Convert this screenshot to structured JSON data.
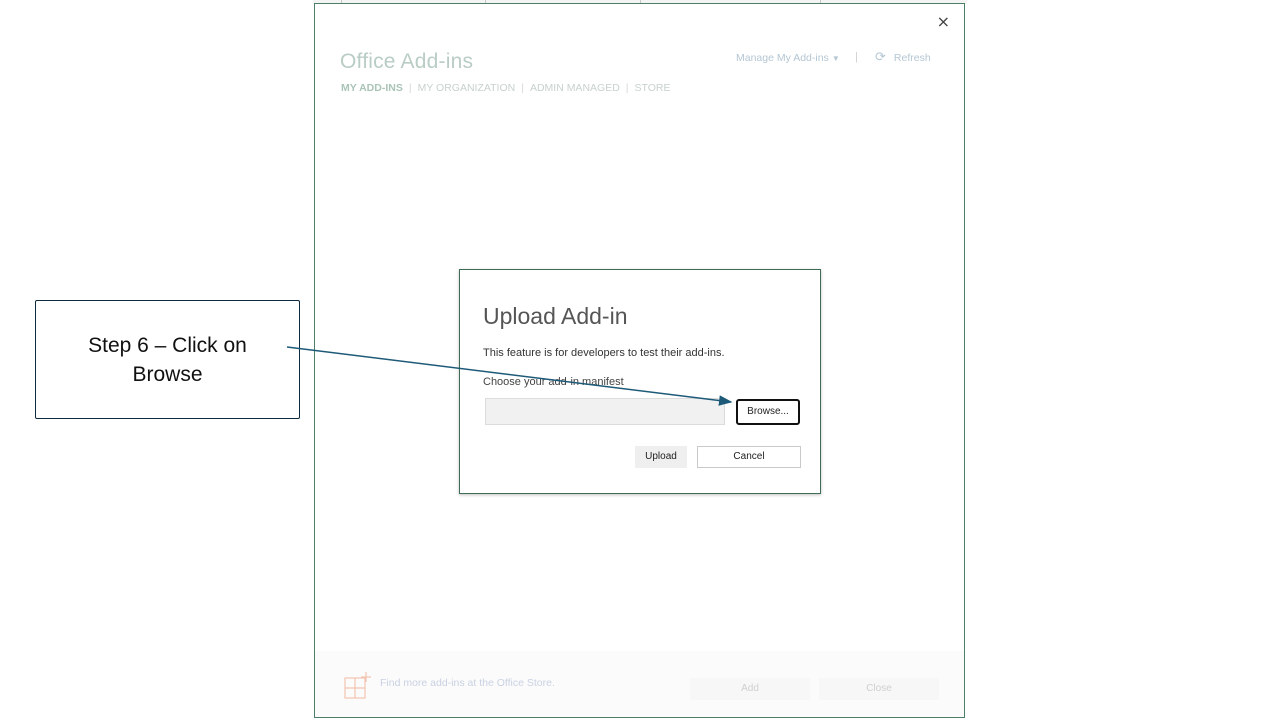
{
  "addins_dialog": {
    "title": "Office Add-ins",
    "tabs": [
      {
        "label": "MY ADD-INS",
        "active": true
      },
      {
        "label": "MY ORGANIZATION",
        "active": false
      },
      {
        "label": "ADMIN MANAGED",
        "active": false
      },
      {
        "label": "STORE",
        "active": false
      }
    ],
    "manage_label": "Manage My Add-ins",
    "refresh_label": "Refresh",
    "close_glyph": "×",
    "footer": {
      "store_text": "Find more add-ins at the Office Store.",
      "add_label": "Add",
      "close_label": "Close"
    }
  },
  "upload_modal": {
    "title": "Upload Add-in",
    "description": "This feature is for developers to test their add-ins.",
    "manifest_label": "Choose your add-in manifest",
    "manifest_value": "",
    "browse_label": "Browse...",
    "upload_label": "Upload",
    "cancel_label": "Cancel"
  },
  "callout": {
    "text": "Step 6 – Click on Browse"
  },
  "colors": {
    "dialog_border": "#4f7e66",
    "arrow": "#1d5a78",
    "callout_border": "#0e2a3d"
  },
  "icons": [
    "close-icon",
    "chevron-down-icon",
    "refresh-icon",
    "store-add-icon"
  ]
}
